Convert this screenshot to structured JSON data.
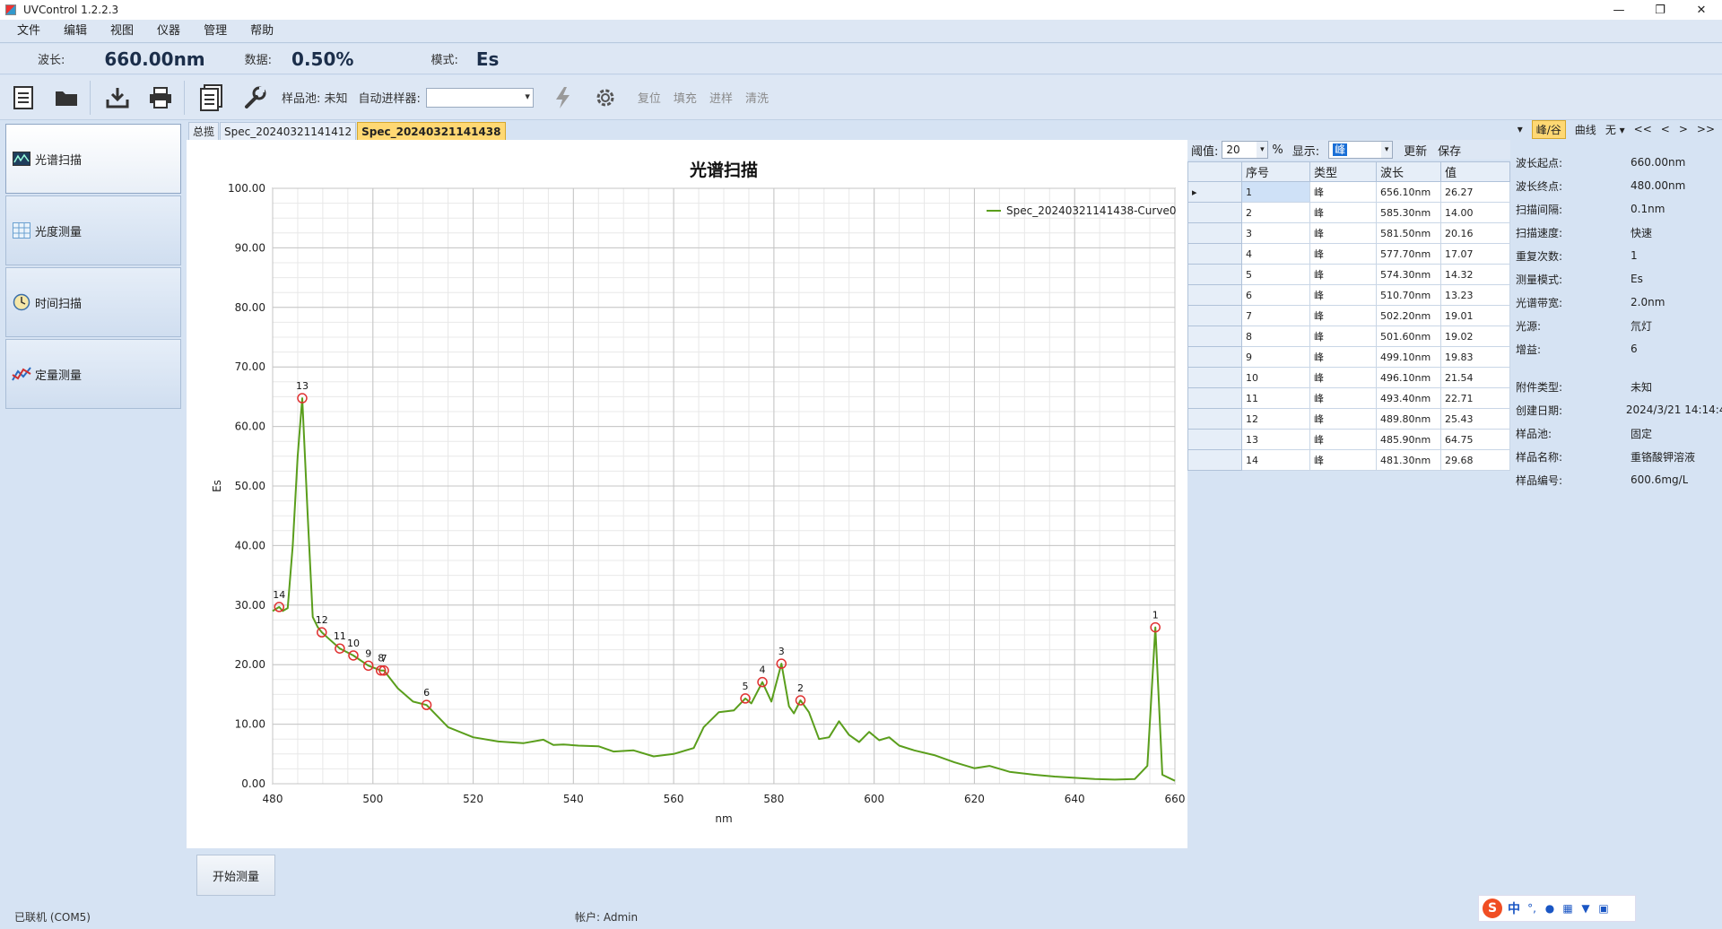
{
  "window": {
    "title": "UVControl 1.2.2.3",
    "controls": [
      "—",
      "❐",
      "✕"
    ]
  },
  "menu": [
    "文件",
    "编辑",
    "视图",
    "仪器",
    "管理",
    "帮助"
  ],
  "status": {
    "wavelength_label": "波长:",
    "wavelength_value": "660.00nm",
    "data_label": "数据:",
    "data_value": "0.50%",
    "mode_label": "模式:",
    "mode_value": "Es"
  },
  "toolbar": {
    "sample_cell": "样品池: 未知",
    "autosampler_label": "自动进样器:",
    "reset": "复位",
    "fill": "填充",
    "inject": "进样",
    "wash": "清洗"
  },
  "nav": [
    "光谱扫描",
    "光度测量",
    "时间扫描",
    "定量测量"
  ],
  "tabs": [
    "总揽",
    "Spec_20240321141412",
    "Spec_20240321141438"
  ],
  "right_header": {
    "dropdown": "▾",
    "peak_valley": "峰/谷",
    "curve": "曲线",
    "none": "无 ▾",
    "first": "<<",
    "prev": "<",
    "next": ">",
    "last": ">>"
  },
  "controls": {
    "threshold_label": "阈值:",
    "threshold_value": "20",
    "percent": "%",
    "display_label": "显示:",
    "display_value": "峰",
    "update": "更新",
    "save": "保存"
  },
  "peak_table": {
    "headers": [
      "序号",
      "类型",
      "波长",
      "值"
    ],
    "rows": [
      [
        "1",
        "峰",
        "656.10nm",
        "26.27"
      ],
      [
        "2",
        "峰",
        "585.30nm",
        "14.00"
      ],
      [
        "3",
        "峰",
        "581.50nm",
        "20.16"
      ],
      [
        "4",
        "峰",
        "577.70nm",
        "17.07"
      ],
      [
        "5",
        "峰",
        "574.30nm",
        "14.32"
      ],
      [
        "6",
        "峰",
        "510.70nm",
        "13.23"
      ],
      [
        "7",
        "峰",
        "502.20nm",
        "19.01"
      ],
      [
        "8",
        "峰",
        "501.60nm",
        "19.02"
      ],
      [
        "9",
        "峰",
        "499.10nm",
        "19.83"
      ],
      [
        "10",
        "峰",
        "496.10nm",
        "21.54"
      ],
      [
        "11",
        "峰",
        "493.40nm",
        "22.71"
      ],
      [
        "12",
        "峰",
        "489.80nm",
        "25.43"
      ],
      [
        "13",
        "峰",
        "485.90nm",
        "64.75"
      ],
      [
        "14",
        "峰",
        "481.30nm",
        "29.68"
      ]
    ]
  },
  "properties": [
    {
      "k": "波长起点:",
      "v": "660.00nm"
    },
    {
      "k": "波长终点:",
      "v": "480.00nm"
    },
    {
      "k": "扫描间隔:",
      "v": "0.1nm"
    },
    {
      "k": "扫描速度:",
      "v": "快速"
    },
    {
      "k": "重复次数:",
      "v": "1"
    },
    {
      "k": "测量模式:",
      "v": "Es"
    },
    {
      "k": "光谱带宽:",
      "v": "2.0nm"
    },
    {
      "k": "光源:",
      "v": "氘灯"
    },
    {
      "k": "增益:",
      "v": "6"
    },
    {
      "k": "附件类型:",
      "v": "未知"
    },
    {
      "k": "创建日期:",
      "v": "2024/3/21 14:14:4"
    },
    {
      "k": "样品池:",
      "v": "固定"
    },
    {
      "k": "样品名称:",
      "v": "重铬酸钾溶液"
    },
    {
      "k": "样品编号:",
      "v": "600.6mg/L"
    }
  ],
  "start_button": "开始测量",
  "statusbar": {
    "connection": "已联机 (COM5)",
    "account": "帐户: Admin"
  },
  "ime": {
    "lang": "中"
  },
  "colors": {
    "curve": "#5a9e1c",
    "marker": "#e03030",
    "tab_active": "#ffd873",
    "background": "#d6e3f3"
  },
  "chart_data": {
    "type": "line",
    "title": "光谱扫描",
    "xlabel": "nm",
    "ylabel": "Es",
    "xlim": [
      480,
      660
    ],
    "ylim": [
      0,
      100
    ],
    "xticks": [
      480,
      500,
      520,
      540,
      560,
      580,
      600,
      620,
      640,
      660
    ],
    "yticks": [
      "0.00",
      "10.00",
      "20.00",
      "30.00",
      "40.00",
      "50.00",
      "60.00",
      "70.00",
      "80.00",
      "90.00",
      "100.00"
    ],
    "grid": true,
    "legend_position": "top-right",
    "series": [
      {
        "name": "Spec_20240321141438-Curve0",
        "x": [
          480,
          481.3,
          482,
          483,
          484,
          485,
          485.9,
          487,
          488,
          489,
          489.8,
          491,
          493.4,
          496.1,
          499.1,
          501.6,
          502.2,
          505,
          508,
          510.7,
          515,
          520,
          525,
          530,
          534,
          536,
          538,
          541,
          545,
          548,
          552,
          556,
          560,
          564,
          566,
          569,
          572,
          574.3,
          575.5,
          577.7,
          579.5,
          581.5,
          583,
          584,
          585.3,
          587,
          589,
          591,
          593,
          595,
          597,
          599,
          601,
          603,
          605,
          608,
          612,
          616,
          620,
          623,
          627,
          632,
          636,
          640,
          644,
          648,
          652,
          654.5,
          656.1,
          657.5,
          660
        ],
        "y": [
          29.0,
          29.68,
          29.0,
          29.5,
          40,
          55,
          64.75,
          45,
          28,
          26.3,
          25.43,
          24.5,
          22.71,
          21.54,
          19.83,
          19.02,
          19.01,
          16,
          13.8,
          13.23,
          9.5,
          7.8,
          7.1,
          6.8,
          7.4,
          6.5,
          6.6,
          6.4,
          6.3,
          5.4,
          5.6,
          4.6,
          5.0,
          6.0,
          9.5,
          12.0,
          12.3,
          14.32,
          13.5,
          17.07,
          13.8,
          20.16,
          13.0,
          11.8,
          14.0,
          12.0,
          7.5,
          7.8,
          10.5,
          8.2,
          7.0,
          8.7,
          7.3,
          7.8,
          6.4,
          5.6,
          4.8,
          3.6,
          2.6,
          3.0,
          2.0,
          1.5,
          1.2,
          1.0,
          0.8,
          0.7,
          0.8,
          3.0,
          26.27,
          1.5,
          0.5
        ]
      }
    ],
    "peaks": [
      {
        "label": "1",
        "x": 656.1,
        "y": 26.27
      },
      {
        "label": "2",
        "x": 585.3,
        "y": 14.0
      },
      {
        "label": "3",
        "x": 581.5,
        "y": 20.16
      },
      {
        "label": "4",
        "x": 577.7,
        "y": 17.07
      },
      {
        "label": "5",
        "x": 574.3,
        "y": 14.32
      },
      {
        "label": "6",
        "x": 510.7,
        "y": 13.23
      },
      {
        "label": "7",
        "x": 502.2,
        "y": 19.01
      },
      {
        "label": "8",
        "x": 501.6,
        "y": 19.02
      },
      {
        "label": "9",
        "x": 499.1,
        "y": 19.83
      },
      {
        "label": "10",
        "x": 496.1,
        "y": 21.54
      },
      {
        "label": "11",
        "x": 493.4,
        "y": 22.71
      },
      {
        "label": "12",
        "x": 489.8,
        "y": 25.43
      },
      {
        "label": "13",
        "x": 485.9,
        "y": 64.75
      },
      {
        "label": "14",
        "x": 481.3,
        "y": 29.68
      }
    ]
  }
}
